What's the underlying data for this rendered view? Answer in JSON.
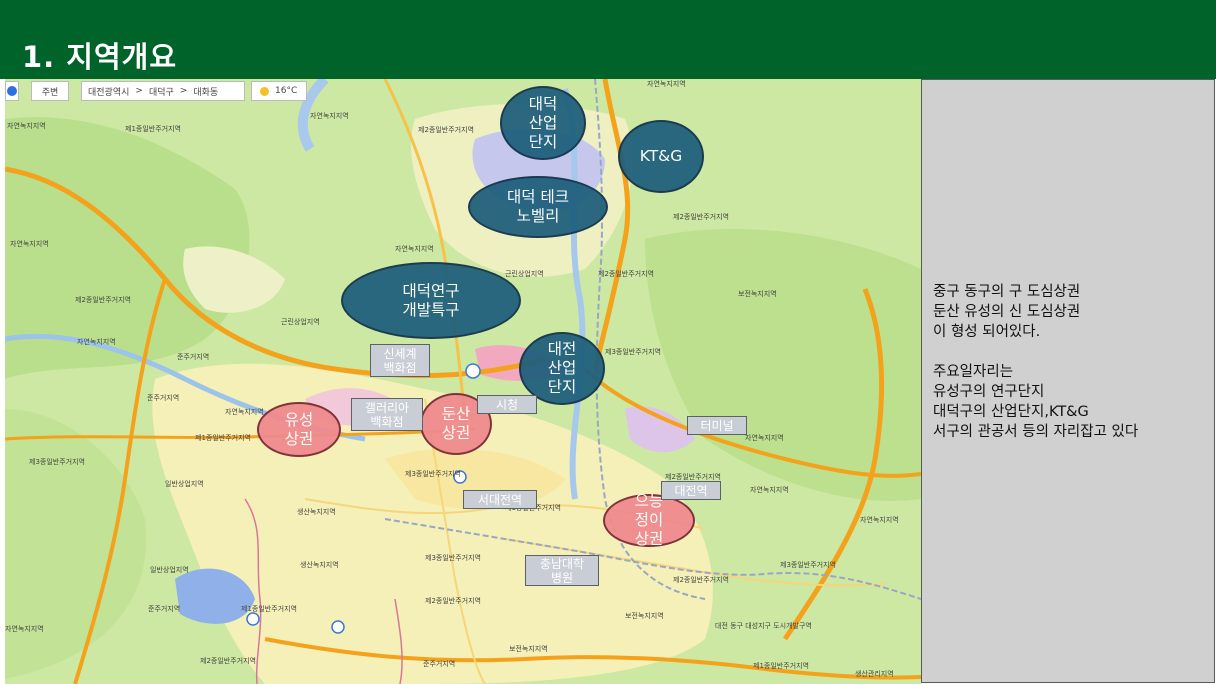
{
  "header": {
    "title": "1. 지역개요"
  },
  "map": {
    "toolbar": {
      "back": "주변",
      "breadcrumb": [
        "대전광역시",
        "대덕구",
        "대화동"
      ],
      "separator": ">",
      "weather": "16°C"
    },
    "zones": [
      {
        "text": "대덕\n산업\n단지"
      },
      {
        "text": "KT&G"
      },
      {
        "text": "대덕 테크\n노벨리"
      },
      {
        "text": "대덕연구\n개발특구"
      },
      {
        "text": "대전\n산업\n단지"
      },
      {
        "text": "유성\n상권"
      },
      {
        "text": "둔산\n상권"
      },
      {
        "text": "으능\n정이\n상권"
      }
    ],
    "tags": [
      {
        "text": "신세계\n백화점"
      },
      {
        "text": "갤러리아\n백화점"
      },
      {
        "text": "시청"
      },
      {
        "text": "터미널"
      },
      {
        "text": "대전역"
      },
      {
        "text": "서대전역"
      },
      {
        "text": "충남대학\n병원"
      }
    ],
    "labels": [
      "자연녹지지역",
      "제1종일반주거지역",
      "근린상업지역",
      "제2종일반주거지역",
      "제3종일반주거지역",
      "보전녹지지역",
      "준주거지역",
      "생산녹지지역",
      "일반상업지역",
      "대전 동구 대성지구 도시개발구역",
      "생산관리지역"
    ]
  },
  "side": {
    "lines": [
      "중구 동구의 구 도심상권",
      "둔산 유성의 신 도심상권",
      "이 형성 되어있다.",
      "",
      "주요일자리는",
      "유성구의 연구단지",
      "대덕구의 산업단지,KT&G",
      "서구의 관공서 등의 자리잡고 있다"
    ]
  },
  "colors": {
    "header": "#006329",
    "zone_blue": "#1d5e7c",
    "zone_pink": "#ef8a8d",
    "tag": "#c9ced6",
    "panel": "#d0d0d0"
  }
}
